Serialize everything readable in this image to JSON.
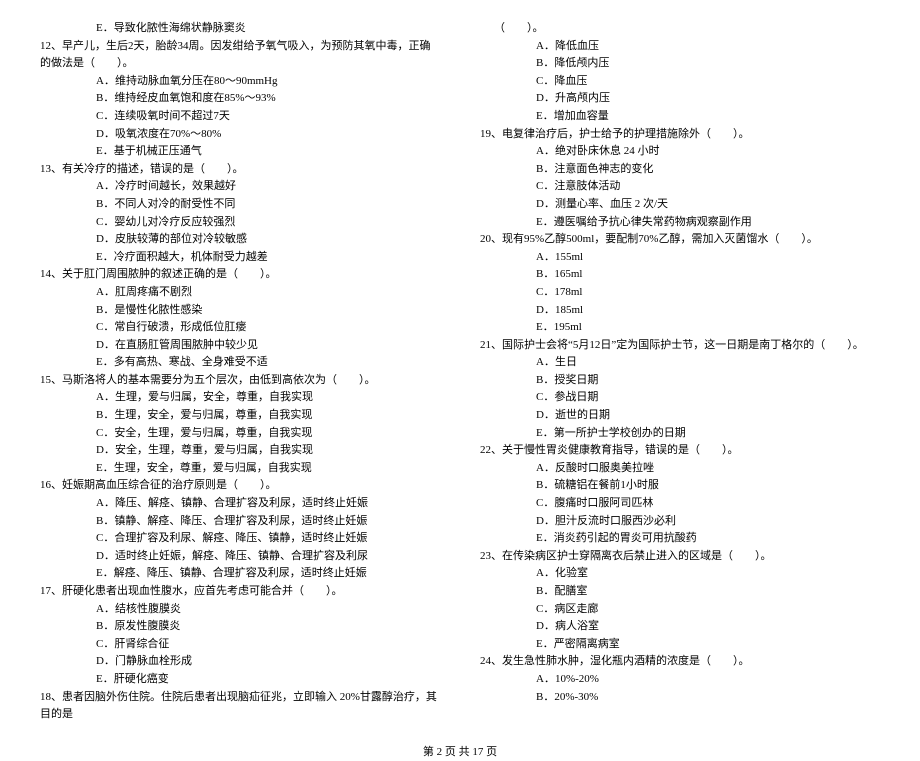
{
  "left": {
    "pre_e": "E．导致化脓性海绵状静脉窦炎",
    "q12": {
      "num": "12、",
      "text": "早产儿，生后2天，胎龄34周。因发绀给予氧气吸入，为预防其氧中毒，正确的做法是（　　）。",
      "opts": [
        "A．维持动脉血氧分压在80～90mmHg",
        "B．维持经皮血氧饱和度在85%～93%",
        "C．连续吸氧时间不超过7天",
        "D．吸氧浓度在70%～80%",
        "E．基于机械正压通气"
      ]
    },
    "q13": {
      "num": "13、",
      "text": "有关冷疗的描述，错误的是（　　）。",
      "opts": [
        "A．冷疗时间越长，效果越好",
        "B．不同人对冷的耐受性不同",
        "C．婴幼儿对冷疗反应较强烈",
        "D．皮肤较薄的部位对冷较敏感",
        "E．冷疗面积越大，机体耐受力越差"
      ]
    },
    "q14": {
      "num": "14、",
      "text": "关于肛门周围脓肿的叙述正确的是（　　）。",
      "opts": [
        "A．肛周疼痛不剧烈",
        "B．是慢性化脓性感染",
        "C．常自行破溃，形成低位肛瘘",
        "D．在直肠肛管周围脓肿中较少见",
        "E．多有高热、寒战、全身难受不适"
      ]
    },
    "q15": {
      "num": "15、",
      "text": "马斯洛将人的基本需要分为五个层次，由低到高依次为（　　）。",
      "opts": [
        "A．生理，爱与归属，安全，尊重，自我实现",
        "B．生理，安全，爱与归属，尊重，自我实现",
        "C．安全，生理，爱与归属，尊重，自我实现",
        "D．安全，生理，尊重，爱与归属，自我实现",
        "E．生理，安全，尊重，爱与归属，自我实现"
      ]
    },
    "q16": {
      "num": "16、",
      "text": "妊娠期高血压综合征的治疗原则是（　　）。",
      "opts": [
        "A．降压、解痉、镇静、合理扩容及利尿，适时终止妊娠",
        "B．镇静、解痉、降压、合理扩容及利尿，适时终止妊娠",
        "C．合理扩容及利尿、解痉、降压、镇静，适时终止妊娠",
        "D．适时终止妊娠，解痉、降压、镇静、合理扩容及利尿",
        "E．解痉、降压、镇静、合理扩容及利尿，适时终止妊娠"
      ]
    },
    "q17": {
      "num": "17、",
      "text": "肝硬化患者出现血性腹水，应首先考虑可能合并（　　）。",
      "opts": [
        "A．结核性腹膜炎",
        "B．原发性腹膜炎",
        "C．肝肾综合征",
        "D．门静脉血栓形成",
        "E．肝硬化癌变"
      ]
    },
    "q18": {
      "num": "18、",
      "text": "患者因脑外伤住院。住院后患者出现脑疝征兆，立即输入 20%甘露醇治疗，其目的是"
    }
  },
  "right": {
    "pre": "（　　）。",
    "q18_opts": [
      "A．降低血压",
      "B．降低颅内压",
      "C．降血压",
      "D．升高颅内压",
      "E．增加血容量"
    ],
    "q19": {
      "num": "19、",
      "text": "电复律治疗后，护士给予的护理措施除外（　　）。",
      "opts": [
        "A．绝对卧床休息 24 小时",
        "B．注意面色神志的变化",
        "C．注意肢体活动",
        "D．测量心率、血压 2 次/天",
        "E．遵医嘱给予抗心律失常药物病观察副作用"
      ]
    },
    "q20": {
      "num": "20、",
      "text": "现有95%乙醇500ml，要配制70%乙醇，需加入灭菌馏水（　　）。",
      "opts": [
        "A．155ml",
        "B．165ml",
        "C．178ml",
        "D．185ml",
        "E．195ml"
      ]
    },
    "q21": {
      "num": "21、",
      "text": "国际护士会将“5月12日”定为国际护士节，这一日期是南丁格尔的（　　）。",
      "opts": [
        "A．生日",
        "B．授奖日期",
        "C．参战日期",
        "D．逝世的日期",
        "E．第一所护士学校创办的日期"
      ]
    },
    "q22": {
      "num": "22、",
      "text": "关于慢性胃炎健康教育指导，错误的是（　　）。",
      "opts": [
        "A．反酸时口服奥美拉唑",
        "B．硫糖铝在餐前1小时服",
        "C．腹痛时口服阿司匹林",
        "D．胆汁反流时口服西沙必利",
        "E．消炎药引起的胃炎可用抗酸药"
      ]
    },
    "q23": {
      "num": "23、",
      "text": "在传染病区护士穿隔离衣后禁止进入的区域是（　　）。",
      "opts": [
        "A．化验室",
        "B．配膳室",
        "C．病区走廊",
        "D．病人浴室",
        "E．严密隔离病室"
      ]
    },
    "q24": {
      "num": "24、",
      "text": "发生急性肺水肿，湿化瓶内酒精的浓度是（　　）。",
      "opts": [
        "A．10%-20%",
        "B．20%-30%"
      ]
    }
  },
  "footer": "第 2 页 共 17 页"
}
